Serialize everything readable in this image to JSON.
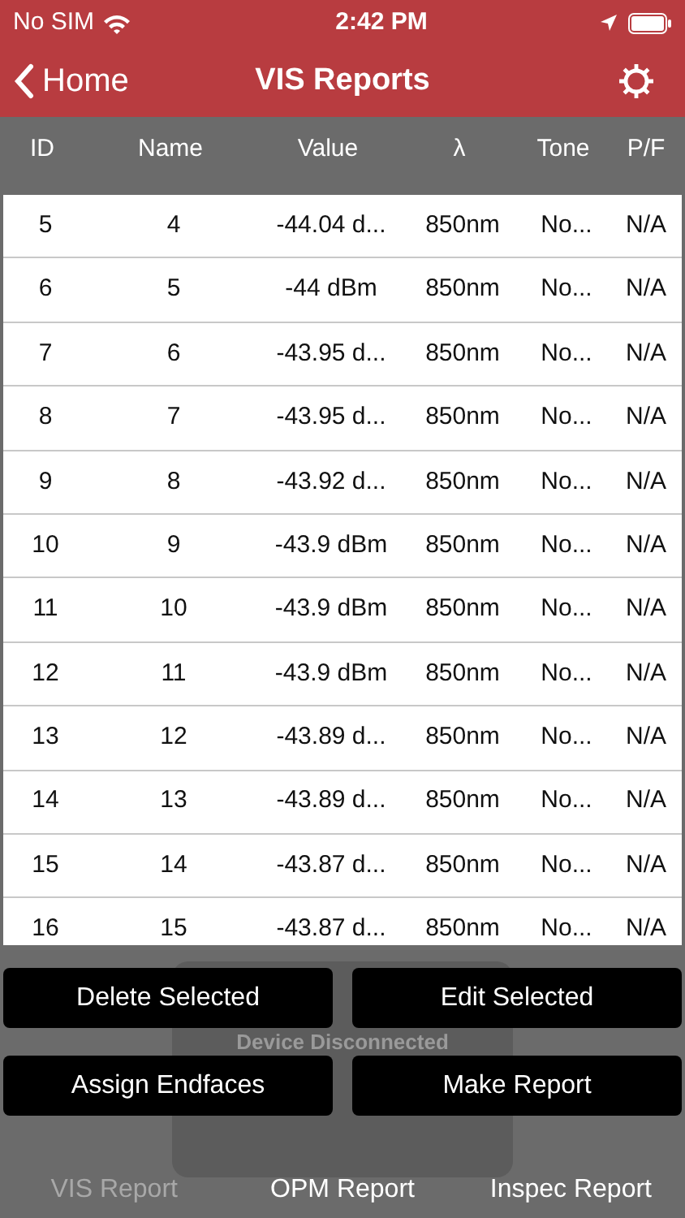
{
  "status_bar": {
    "carrier": "No SIM",
    "time": "2:42 PM"
  },
  "nav": {
    "back": "Home",
    "title": "VIS Reports"
  },
  "table": {
    "columns": [
      "ID",
      "Name",
      "Value",
      "λ",
      "Tone",
      "P/F"
    ],
    "rows": [
      [
        "5",
        "4",
        "-44.04 d...",
        "850nm",
        "No...",
        "N/A"
      ],
      [
        "6",
        "5",
        "-44 dBm",
        "850nm",
        "No...",
        "N/A"
      ],
      [
        "7",
        "6",
        "-43.95 d...",
        "850nm",
        "No...",
        "N/A"
      ],
      [
        "8",
        "7",
        "-43.95 d...",
        "850nm",
        "No...",
        "N/A"
      ],
      [
        "9",
        "8",
        "-43.92 d...",
        "850nm",
        "No...",
        "N/A"
      ],
      [
        "10",
        "9",
        "-43.9 dBm",
        "850nm",
        "No...",
        "N/A"
      ],
      [
        "11",
        "10",
        "-43.9 dBm",
        "850nm",
        "No...",
        "N/A"
      ],
      [
        "12",
        "11",
        "-43.9 dBm",
        "850nm",
        "No...",
        "N/A"
      ],
      [
        "13",
        "12",
        "-43.89 d...",
        "850nm",
        "No...",
        "N/A"
      ],
      [
        "14",
        "13",
        "-43.89 d...",
        "850nm",
        "No...",
        "N/A"
      ],
      [
        "15",
        "14",
        "-43.87 d...",
        "850nm",
        "No...",
        "N/A"
      ],
      [
        "16",
        "15",
        "-43.87 d...",
        "850nm",
        "No...",
        "N/A"
      ]
    ]
  },
  "buttons": [
    "Delete Selected",
    "Edit Selected",
    "Assign Endfaces",
    "Make Report"
  ],
  "toast": "Device Disconnected",
  "tabs": [
    {
      "label": "VIS Report",
      "selected": true
    },
    {
      "label": "OPM Report",
      "selected": false
    },
    {
      "label": "Inspec Report",
      "selected": false
    }
  ]
}
